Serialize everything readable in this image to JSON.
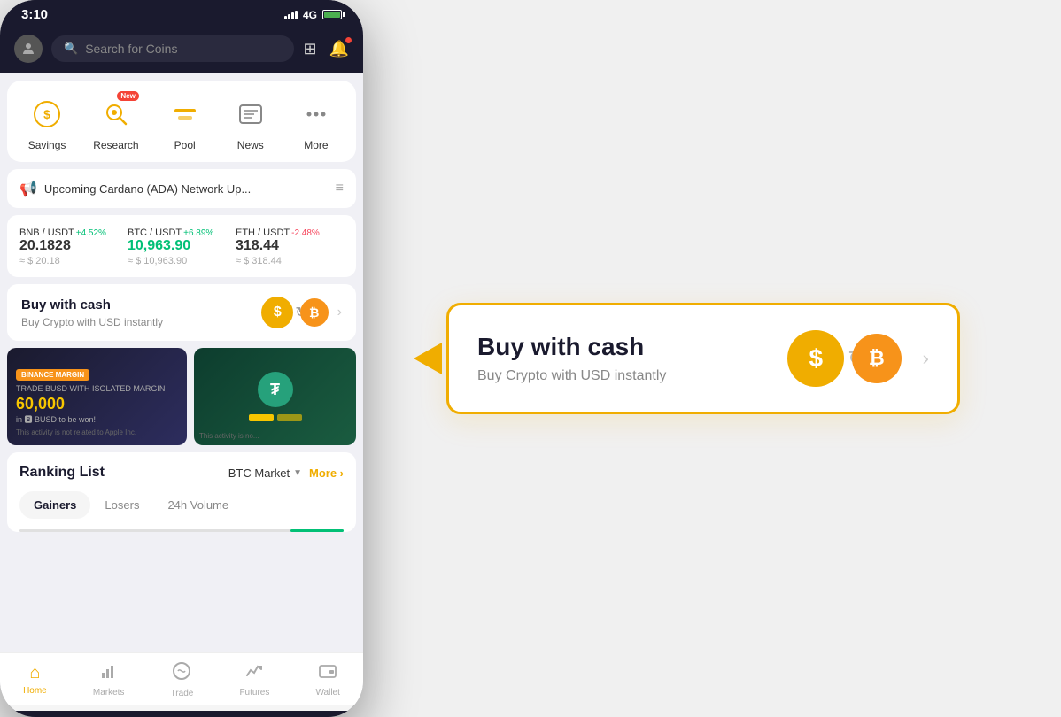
{
  "status_bar": {
    "time": "3:10",
    "signal": "4G"
  },
  "top_bar": {
    "search_placeholder": "Search for Coins"
  },
  "quick_nav": {
    "items": [
      {
        "id": "savings",
        "label": "Savings",
        "icon": "💰",
        "new": false
      },
      {
        "id": "research",
        "label": "Research",
        "icon": "🔬",
        "new": true
      },
      {
        "id": "pool",
        "label": "Pool",
        "icon": "🏊",
        "new": false
      },
      {
        "id": "news",
        "label": "News",
        "icon": "📰",
        "new": false
      },
      {
        "id": "more",
        "label": "More",
        "icon": "⋯",
        "new": false
      }
    ]
  },
  "announcement": {
    "text": "Upcoming Cardano (ADA) Network Up..."
  },
  "prices": [
    {
      "pair": "BNB / USDT",
      "change": "+4.52%",
      "positive": true,
      "value": "20.1828",
      "usd": "≈ $ 20.18"
    },
    {
      "pair": "BTC / USDT",
      "change": "+6.89%",
      "positive": true,
      "value": "10,963.90",
      "usd": "≈ $ 10,963.90"
    },
    {
      "pair": "ETH / USDT",
      "change": "-2.48%",
      "positive": false,
      "value": "318.44",
      "usd": "≈ $ 318.44"
    }
  ],
  "buy_cash": {
    "title": "Buy with cash",
    "subtitle": "Buy Crypto with USD instantly"
  },
  "banners": [
    {
      "tag": "BINANCE MARGIN",
      "sub": "TRADE BUSD WITH ISOLATED MARGIN",
      "amount": "60,000",
      "unit": "in BUSD to be won!",
      "disclaimer": "This activity is not related to Apple Inc."
    },
    {
      "disclaimer": "This activity is no..."
    }
  ],
  "ranking": {
    "title": "Ranking List",
    "filter": "BTC Market",
    "more": "More",
    "tabs": [
      "Gainers",
      "Losers",
      "24h Volume"
    ]
  },
  "callout": {
    "title": "Buy with cash",
    "subtitle": "Buy Crypto with USD instantly"
  },
  "bottom_nav": {
    "items": [
      {
        "id": "home",
        "label": "Home",
        "active": true,
        "icon": "🏠"
      },
      {
        "id": "markets",
        "label": "Markets",
        "active": false,
        "icon": "📊"
      },
      {
        "id": "trade",
        "label": "Trade",
        "active": false,
        "icon": "🔄"
      },
      {
        "id": "futures",
        "label": "Futures",
        "active": false,
        "icon": "📈"
      },
      {
        "id": "wallet",
        "label": "Wallet",
        "active": false,
        "icon": "👛"
      }
    ]
  }
}
